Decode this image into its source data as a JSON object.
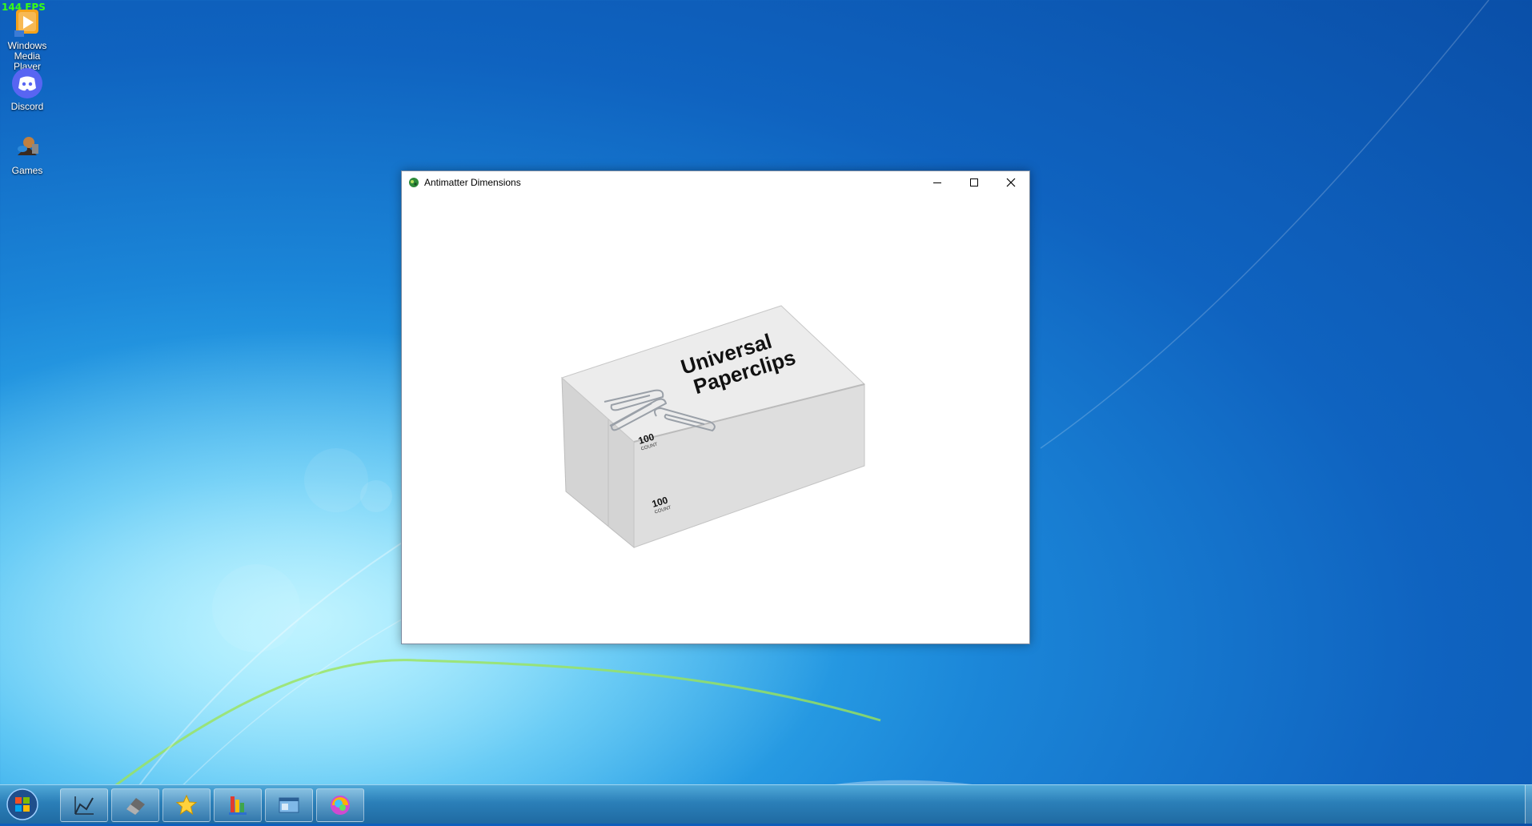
{
  "fps_counter": "144 FPS",
  "desktop": {
    "icons": [
      {
        "label": "Windows Media Player",
        "icon": "windows-media-player-icon"
      },
      {
        "label": "Discord",
        "icon": "discord-icon"
      },
      {
        "label": "Games",
        "icon": "games-icon"
      }
    ]
  },
  "window": {
    "title": "Antimatter Dimensions",
    "app_icon": "antimatter-dimensions-icon",
    "buttons": {
      "minimize": "minimize-icon",
      "maximize": "maximize-icon",
      "close": "close-icon"
    },
    "content": {
      "box_brand_line1": "Universal",
      "box_brand_line2": "Paperclips",
      "box_count": "100",
      "box_count_label": "COUNT"
    }
  },
  "taskbar": {
    "start_icon": "windows-orb-icon",
    "items": [
      {
        "icon": "graph-tool-icon"
      },
      {
        "icon": "eraser-icon"
      },
      {
        "icon": "star-icon"
      },
      {
        "icon": "colorful-bars-icon"
      },
      {
        "icon": "window-preview-icon"
      },
      {
        "icon": "rainbow-ball-icon"
      }
    ]
  },
  "colors": {
    "desktop_blue": "#1b86d8",
    "taskbar": "#2b7fb8",
    "fps_green": "#39ff14"
  }
}
